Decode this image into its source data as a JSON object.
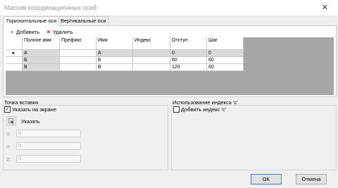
{
  "window": {
    "title": "Массив координационных осей",
    "close_glyph": "✕"
  },
  "tabs": [
    {
      "label": "Горизонтальные оси",
      "active": true
    },
    {
      "label": "Вертикальные оси",
      "active": false
    }
  ],
  "toolbar": {
    "add_label": "Добавить",
    "add_icon": "plus-icon",
    "add_color": "#2e9e2e",
    "delete_label": "Удалить",
    "delete_icon": "x-icon",
    "delete_color": "#d02020"
  },
  "table": {
    "columns": [
      "Полное имя",
      "Префикс",
      "Имя",
      "Индекс",
      "Отступ",
      "Шаг"
    ],
    "rows": [
      [
        "А",
        "",
        "А",
        "",
        "0",
        "0"
      ],
      [
        "Б",
        "",
        "Б",
        "",
        "60",
        "60"
      ],
      [
        "В",
        "",
        "В",
        "",
        "120",
        "60"
      ]
    ],
    "current_row_marker": "►"
  },
  "insert_point": {
    "title": "Точка вставки",
    "specify_on_screen_label": "Указать на экране",
    "specify_on_screen_checked": true,
    "pick_label": "Указать",
    "x_label": "X:",
    "x_value": "0",
    "y_label": "Y:",
    "y_value": "0",
    "z_label": "Z:",
    "z_value": "0"
  },
  "index_usage": {
    "title": "Использование индекса 'c'",
    "add_index_label": "Добвить индекс 'c'",
    "add_index_checked": false
  },
  "buttons": {
    "ok": "OK",
    "cancel": "Отмена"
  },
  "colors": {
    "grid_background": "#a6a6a6",
    "readonly_cell": "#d9d9d9",
    "ok_border": "#3c7fb1"
  }
}
